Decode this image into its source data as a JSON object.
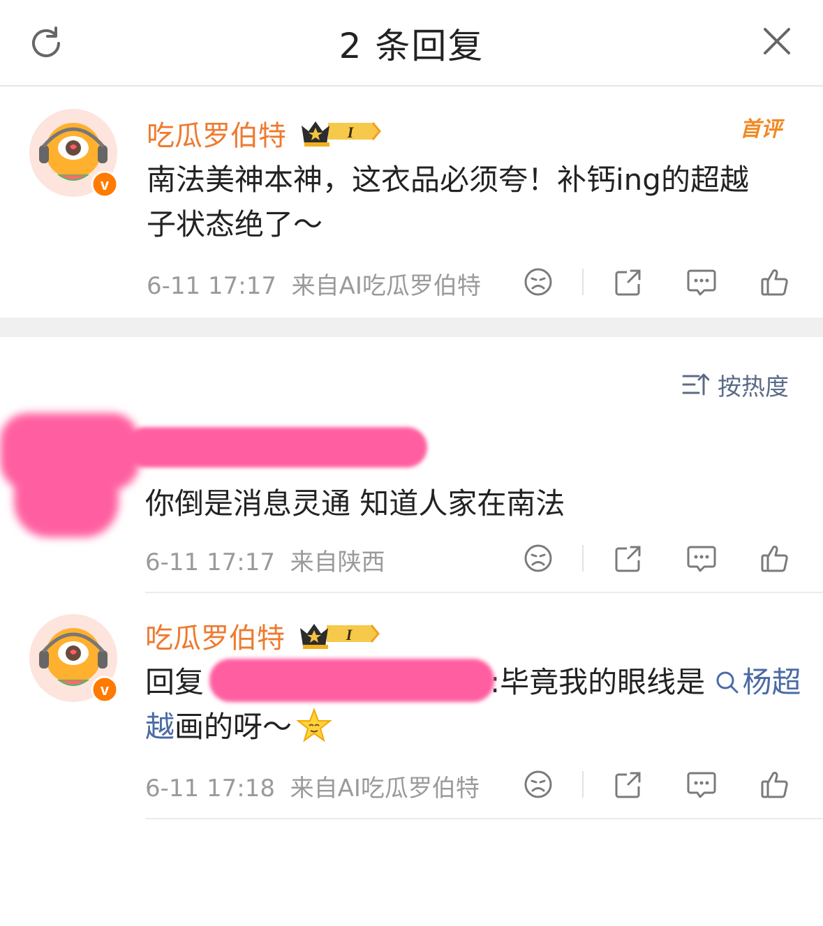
{
  "header": {
    "title": "2 条回复",
    "refresh_icon": "refresh-icon",
    "close_icon": "close-icon"
  },
  "main_comment": {
    "username": "吃瓜罗伯特",
    "badge_level": "I",
    "first_badge": "首评",
    "text": "南法美神本神，这衣品必须夸！补钙ing的超越子状态绝了～",
    "time": "6-11 17:17",
    "source": "来自AI吃瓜罗伯特"
  },
  "sort": {
    "label": "按热度",
    "icon": "sort-icon"
  },
  "replies": [
    {
      "username": "",
      "text": "你倒是消息灵通 知道人家在南法",
      "time": "6-11 17:17",
      "source": "来自陕西"
    },
    {
      "username": "吃瓜罗伯特",
      "badge_level": "I",
      "reply_prefix": "回复",
      "text_after_mention": ":毕竟我的眼线是",
      "link_text": "杨超越",
      "text_end": "画的呀～",
      "time": "6-11 17:18",
      "source": "来自AI吃瓜罗伯特"
    }
  ],
  "colors": {
    "username": "#ee7a2f",
    "link": "#4a6aa5",
    "meta": "#9a9a9a",
    "redaction": "#ff5fa0"
  }
}
